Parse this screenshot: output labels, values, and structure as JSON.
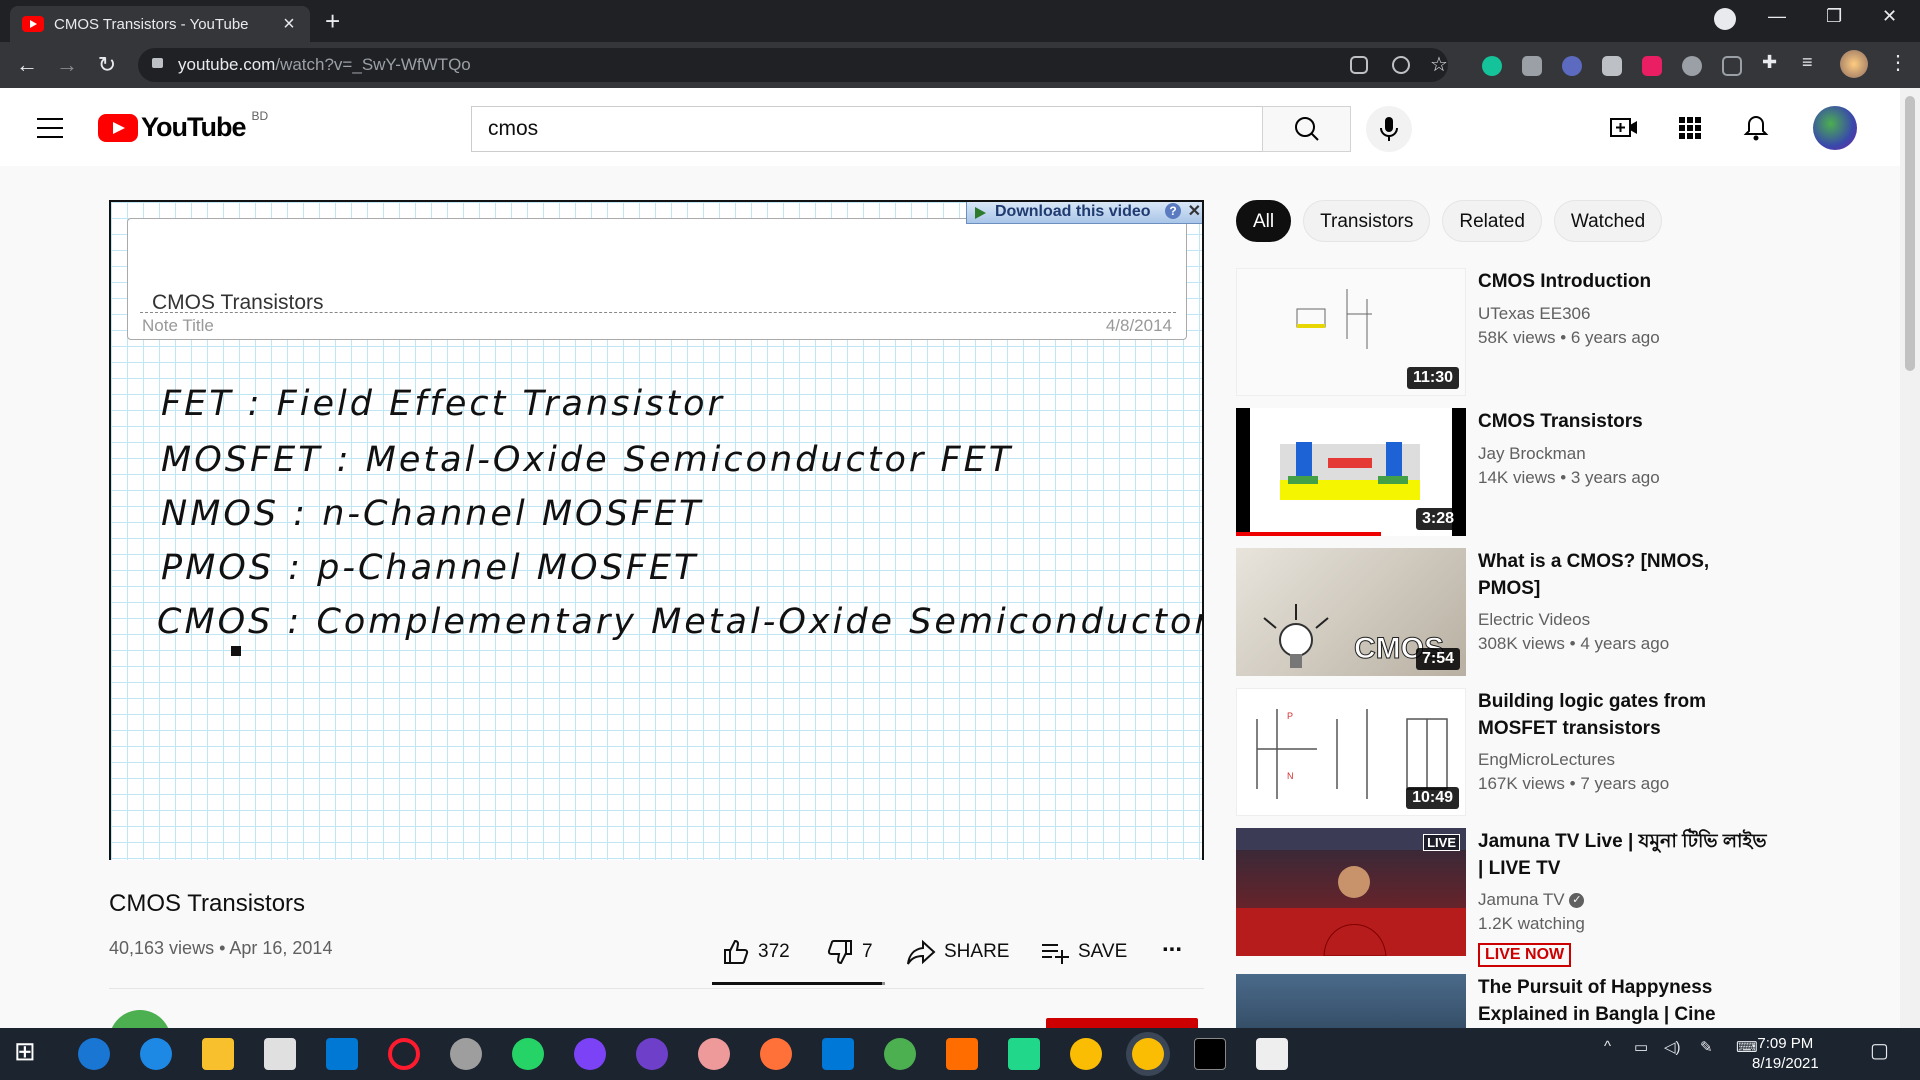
{
  "browser": {
    "tab_title": "CMOS Transistors - YouTube",
    "url_host": "youtube.com",
    "url_path": "/watch?v=_SwY-WfWTQo"
  },
  "header": {
    "logo_text": "YouTube",
    "country_code": "BD",
    "search_value": "cmos"
  },
  "player": {
    "download_label": "Download this video",
    "help_label": "?",
    "note_heading": "CMOS Transistors",
    "note_label": "Note Title",
    "note_date": "4/8/2014",
    "handwriting": [
      "FET : Field Effect Transistor",
      "MOSFET : Metal-Oxide Semiconductor FET",
      "NMOS : n-Channel MOSFET",
      "PMOS : p-Channel MOSFET",
      "CMOS : Complementary Metal-Oxide Semiconductor"
    ]
  },
  "video": {
    "title": "CMOS Transistors",
    "meta": "40,163 views • Apr 16, 2014",
    "likes": "372",
    "dislikes": "7",
    "like_ratio": 0.98,
    "share_label": "SHARE",
    "save_label": "SAVE",
    "more_label": "..."
  },
  "chips": [
    "All",
    "Transistors",
    "Related",
    "Watched"
  ],
  "recommendations": [
    {
      "title": "CMOS Introduction",
      "channel": "UTexas EE306",
      "stats": "58K views • 6 years ago",
      "duration": "11:30"
    },
    {
      "title": "CMOS Transistors",
      "channel": "Jay Brockman",
      "stats": "14K views • 3 years ago",
      "duration": "3:28"
    },
    {
      "title": "What is a CMOS? [NMOS, PMOS]",
      "channel": "Electric Videos",
      "stats": "308K views • 4 years ago",
      "duration": "7:54"
    },
    {
      "title": "Building logic gates from MOSFET transistors",
      "channel": "EngMicroLectures",
      "stats": "167K views • 7 years ago",
      "duration": "10:49"
    },
    {
      "title": "Jamuna TV Live | যমুনা টিভি লাইভ | LIVE TV",
      "channel": "Jamuna TV",
      "stats": "1.2K watching",
      "badge": "LIVE NOW",
      "thumb_badge": "LIVE"
    },
    {
      "title": "The Pursuit of Happyness Explained in Bangla | Cinema..."
    }
  ],
  "taskbar": {
    "time": "7:09 PM",
    "date": "8/19/2021"
  }
}
